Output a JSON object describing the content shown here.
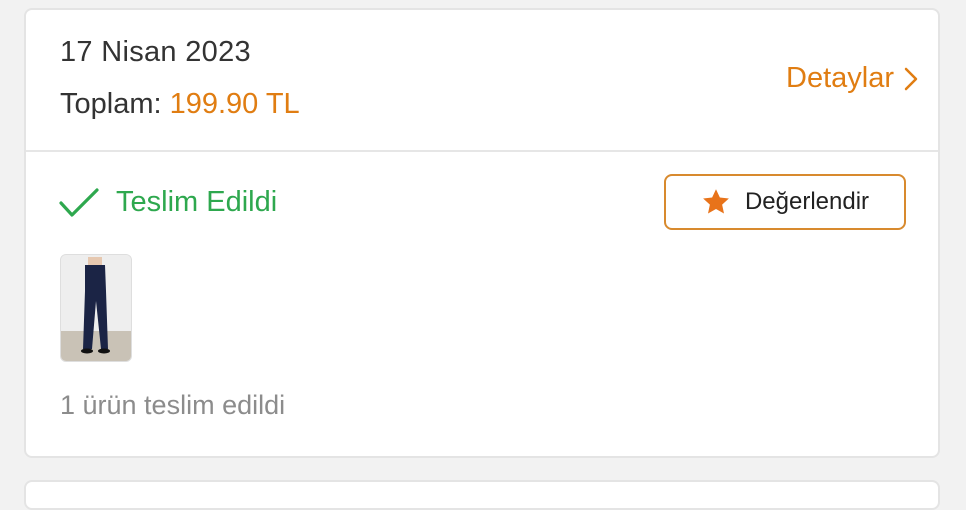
{
  "order": {
    "date": "17 Nisan 2023",
    "total_label": "Toplam:",
    "total_amount": "199.90 TL",
    "details_label": "Detaylar"
  },
  "status": {
    "text": "Teslim Edildi",
    "icon": "checkmark-icon",
    "color": "#2ea84e"
  },
  "actions": {
    "rate_label": "Değerlendir",
    "rate_icon": "star-icon"
  },
  "product": {
    "thumbnail_alt": "navy trousers",
    "delivered_note": "1 ürün teslim edildi"
  },
  "colors": {
    "accent": "#e07d12",
    "success": "#2ea84e"
  }
}
